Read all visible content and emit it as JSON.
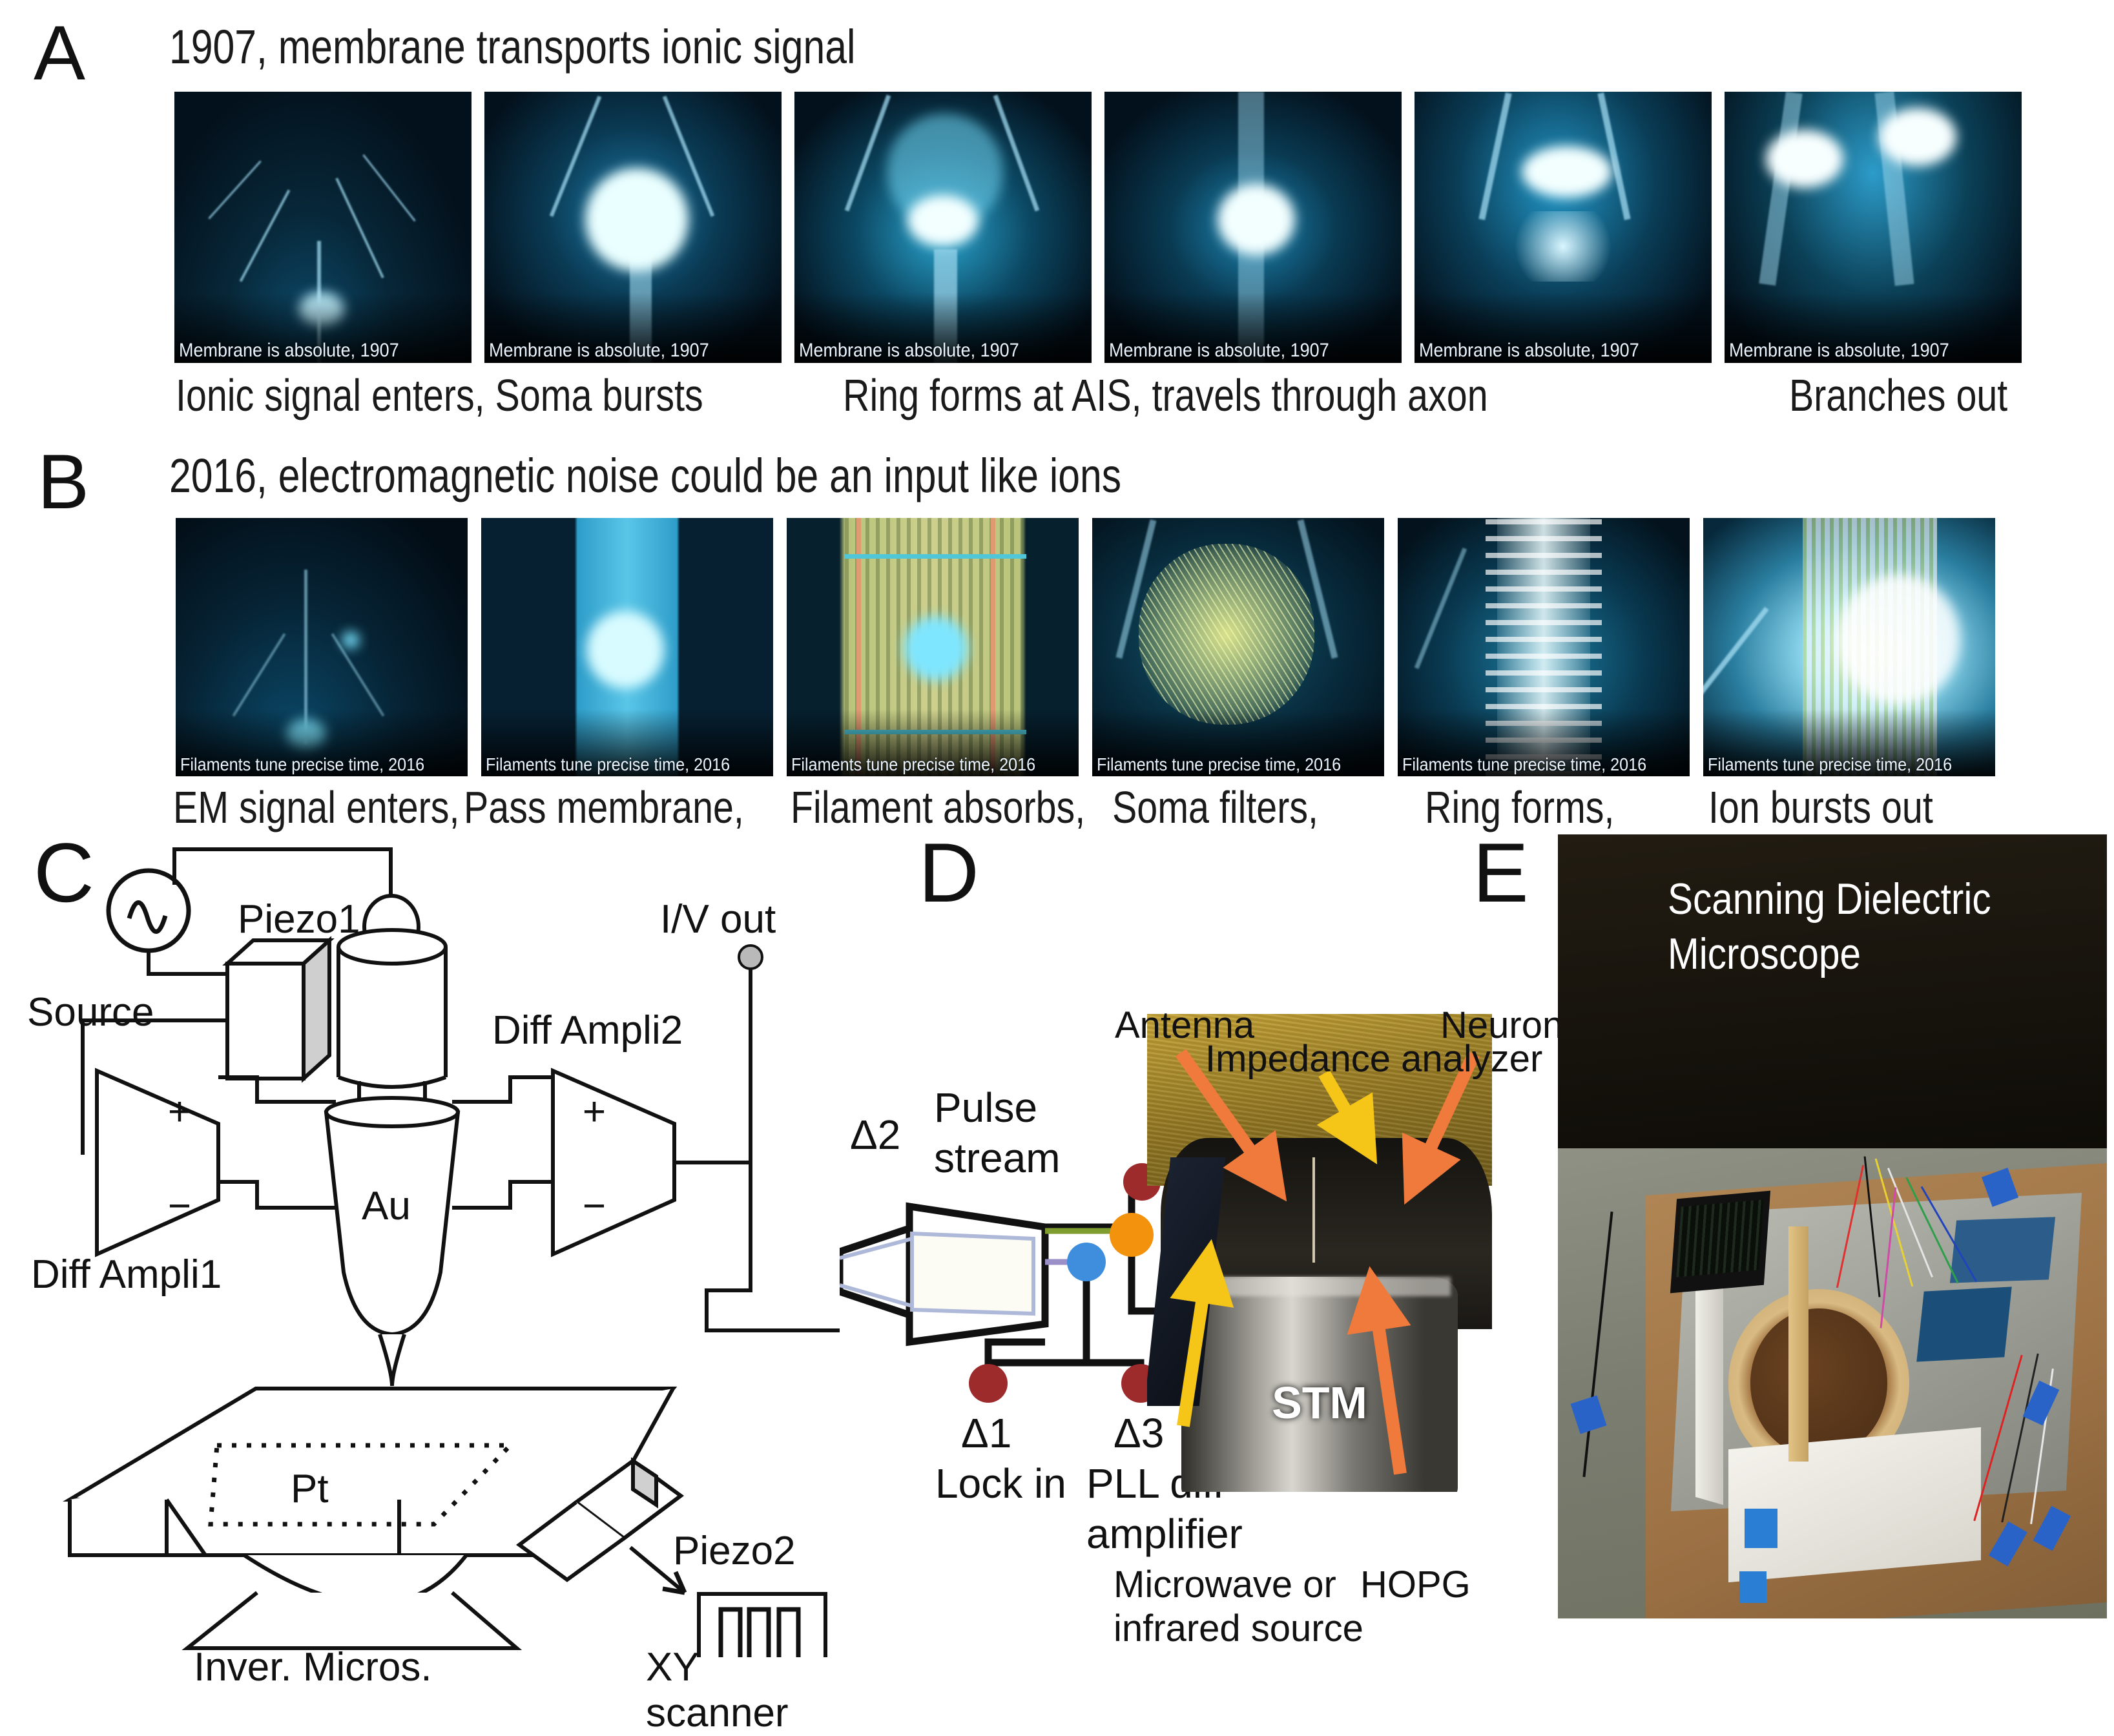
{
  "figure": {
    "panels": [
      "A",
      "B",
      "C",
      "D",
      "E"
    ]
  },
  "panelA": {
    "letter": "A",
    "title": "1907, membrane transports ionic signal",
    "tile_caption": "Membrane is absolute, 1907",
    "tiles": [
      {
        "caption": "Membrane is absolute, 1907"
      },
      {
        "caption": "Membrane is absolute, 1907"
      },
      {
        "caption": "Membrane is absolute, 1907"
      },
      {
        "caption": "Membrane is absolute, 1907"
      },
      {
        "caption": "Membrane is absolute, 1907"
      },
      {
        "caption": "Membrane is absolute, 1907"
      }
    ],
    "captions": [
      "Ionic signal enters, Soma bursts",
      "Ring forms at AIS, travels through axon",
      "Branches out"
    ]
  },
  "panelB": {
    "letter": "B",
    "title": "2016, electromagnetic noise could be an input like ions",
    "tile_caption": "Filaments tune precise time, 2016",
    "tiles": [
      {
        "caption": "Filaments tune precise time, 2016"
      },
      {
        "caption": "Filaments tune precise time, 2016"
      },
      {
        "caption": "Filaments tune precise time, 2016"
      },
      {
        "caption": "Filaments tune precise time, 2016"
      },
      {
        "caption": "Filaments tune precise time, 2016"
      },
      {
        "caption": "Filaments tune precise time, 2016"
      }
    ],
    "captions": [
      "EM signal enters,",
      "Pass membrane,",
      "Filament absorbs,",
      "Soma filters,",
      "Ring forms,",
      "Ion bursts out"
    ]
  },
  "panelC": {
    "letter": "C",
    "labels": {
      "source": "Source",
      "piezo1": "Piezo1",
      "iv_out": "I/V out",
      "diff_ampli1": "Diff Ampli1",
      "diff_ampli2": "Diff Ampli2",
      "au": "Au",
      "pt": "Pt",
      "piezo2": "Piezo2",
      "inverted_microscope": "Inver. Micros.",
      "xy_scanner": "XY scanner",
      "plus": "+",
      "minus": "−"
    }
  },
  "panelD": {
    "letter": "D",
    "labels": {
      "delta1": "Δ1",
      "delta2": "Δ2",
      "delta3": "Δ3",
      "pulse_stream": "Pulse\nstream",
      "pulse_stream_line1": "Pulse",
      "pulse_stream_line2": "stream",
      "lock_in": "Lock in",
      "pll_diff_line1": "PLL diff",
      "pll_diff_line2": "amplifier",
      "antenna": "Antenna",
      "impedance_analyzer": "Impedance  analyzer",
      "neuron": "Neuron",
      "stm": "STM",
      "hopg": "HOPG",
      "microwave_line1": "Microwave or",
      "microwave_line2": "infrared source"
    },
    "node_colors": {
      "red": "#9e2b2b",
      "orange": "#f2920d",
      "blue": "#3f8ddd",
      "green_wire": "#7f9e2f",
      "purple_wire": "#9b8fc7",
      "arrow_orange": "#f07a3c",
      "arrow_yellow": "#f5c518"
    }
  },
  "panelE": {
    "letter": "E",
    "title_line1": "Scanning Dielectric",
    "title_line2": "Microscope"
  }
}
